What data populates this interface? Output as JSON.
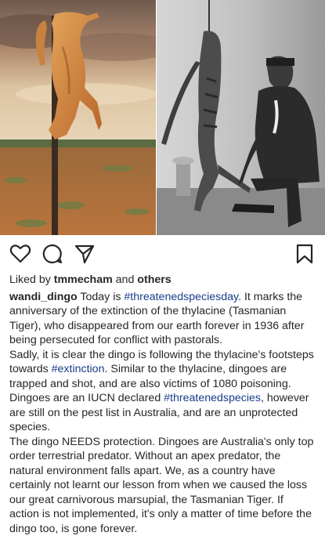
{
  "post": {
    "images": [
      {
        "subject": "dingo carcass hung on a wooden post in outback scrub"
      },
      {
        "subject": "black and white photo of a man with a hanging thylacine carcass"
      }
    ]
  },
  "actions": {
    "icons": [
      "heart-icon",
      "comment-icon",
      "share-icon",
      "bookmark-icon"
    ]
  },
  "likes": {
    "prefix": "Liked by",
    "user": "tmmecham",
    "and": "and",
    "others": "others"
  },
  "caption": {
    "username": "wandi_dingo",
    "p1_a": "Today is",
    "p1_tag": "#threatenedspeciesday",
    "p1_b": ". It marks the anniversary of the extinction of the thylacine (Tasmanian Tiger), who disappeared from our earth forever in 1936 after being persecuted for conflict with pastorals.",
    "p2_a": "Sadly, it is clear the dingo is following the thylacine's footsteps towards",
    "p2_tag": "#extinction",
    "p2_b": ". Similar to the thylacine, dingoes are trapped and shot, and are also victims of 1080 poisoning. Dingoes are an IUCN declared",
    "p2_tag2": "#threatenedspecies",
    "p2_c": ", however are still on the pest list in Australia, and are an unprotected species.",
    "p3": "The dingo NEEDS protection. Dingoes are Australia's only top order terrestrial  predator. Without an apex predator, the natural environment falls apart. We, as a country have certainly not learnt our lesson from when we caused the loss our great carnivorous marsupial, the Tasmanian Tiger. If action is not implemented, it's only a matter of time before the dingo too, is gone forever."
  }
}
